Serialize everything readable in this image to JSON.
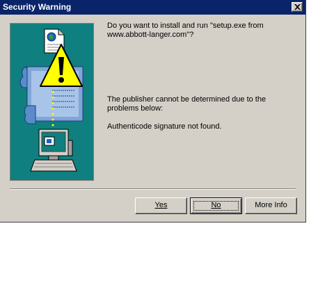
{
  "window": {
    "title": "Security Warning",
    "close_symbol": "✕"
  },
  "illustration": {
    "icons": [
      "document-globe-icon",
      "warning-triangle-icon",
      "certificate-scroll-icon",
      "computer-icon"
    ],
    "background_color": "#0f7f7f"
  },
  "content": {
    "question": "Do you want to install and run \"setup.exe from www.abbott-langer.com\"?",
    "publisher_message": "The publisher cannot be determined due to the problems below:",
    "reason": "Authenticode signature not found."
  },
  "buttons": {
    "yes_label": "Yes",
    "no_label": "No",
    "more_info_label": "More Info"
  },
  "colors": {
    "titlebar": "#0a246a",
    "dialog": "#d4d0c8",
    "warning": "#ffff00"
  }
}
